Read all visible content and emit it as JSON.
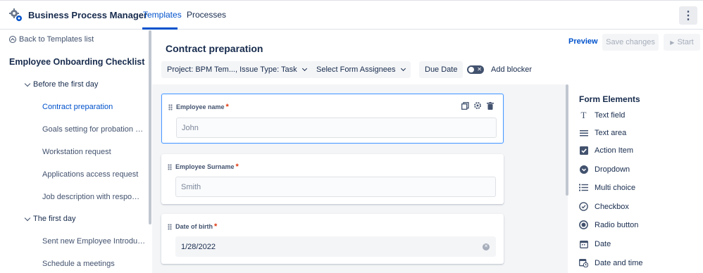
{
  "app": {
    "title": "Business Process Manager"
  },
  "nav": {
    "tabs": [
      {
        "label": "Templates"
      },
      {
        "label": "Processes"
      }
    ],
    "more_icon": "more-vertical-icon"
  },
  "sidebar": {
    "back_label": "Back to Templates list",
    "checklist_title": "Employee Onboarding Checklist",
    "groups": [
      {
        "label": "Before the first day",
        "items": [
          "Contract preparation",
          "Goals setting for probation …",
          "Workstation request",
          "Applications access request",
          "Job description with respo…"
        ]
      },
      {
        "label": "The first day",
        "items": [
          "Sent new Employee Introdu…",
          "Schedule a meetings"
        ]
      }
    ]
  },
  "header": {
    "title": "Contract preparation",
    "preview_label": "Preview",
    "save_label": "Save changes",
    "start_label": "Start",
    "project_label": "Project: BPM Tem..., Issue Type: Task",
    "assignees_label": "Select Form Assignees",
    "due_date_label": "Due Date",
    "blocker_label": "Add blocker",
    "blocker_enabled": false
  },
  "form": {
    "fields": [
      {
        "label": "Employee name",
        "required": "*",
        "value": "John"
      },
      {
        "label": "Employee Surname",
        "required": "*",
        "value": "Smith"
      },
      {
        "label": "Date of birth",
        "required": "*",
        "value": "1/28/2022"
      }
    ]
  },
  "elements_panel": {
    "title": "Form Elements",
    "items": [
      {
        "label": "Text field",
        "icon": "text-field-icon"
      },
      {
        "label": "Text area",
        "icon": "text-area-icon"
      },
      {
        "label": "Action Item",
        "icon": "checkbox-checked-icon"
      },
      {
        "label": "Dropdown",
        "icon": "dropdown-icon"
      },
      {
        "label": "Multi choice",
        "icon": "list-icon"
      },
      {
        "label": "Checkbox",
        "icon": "check-circle-icon"
      },
      {
        "label": "Radio button",
        "icon": "radio-icon"
      },
      {
        "label": "Date",
        "icon": "calendar-icon"
      },
      {
        "label": "Date and time",
        "icon": "calendar-clock-icon"
      }
    ]
  },
  "colors": {
    "accent": "#0052cc",
    "required": "#de350b",
    "selected_border": "#4c9aff"
  }
}
